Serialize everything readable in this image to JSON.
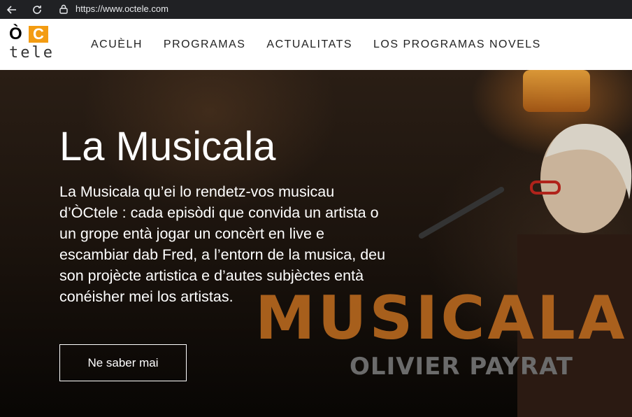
{
  "browser": {
    "url": "https://www.octele.com"
  },
  "logo": {
    "mark_o": "Ò",
    "mark_c": "C",
    "wordmark": "tele"
  },
  "nav": {
    "items": [
      {
        "label": "ACUÈLH"
      },
      {
        "label": "PROGRAMAS"
      },
      {
        "label": "ACTUALITATS"
      },
      {
        "label": "LOS PROGRAMAS NOVELS"
      }
    ]
  },
  "hero": {
    "title": "La Musicala",
    "description": "La Musicala qu’ei lo rendetz-vos musicau d’ÒCtele : cada episòdi que convida un artista o un grope entà jogar un concèrt en live e escambiar dab Fred, a l’entorn de la musica, deu son projècte artistica e d’autes subjèctes entà conéisher mei los artistas.",
    "cta_label": "Ne saber mai",
    "artwork_title": "MUSICALA",
    "artwork_subtitle": "OLIVIER PAYRAT"
  },
  "colors": {
    "accent": "#f39c12"
  }
}
